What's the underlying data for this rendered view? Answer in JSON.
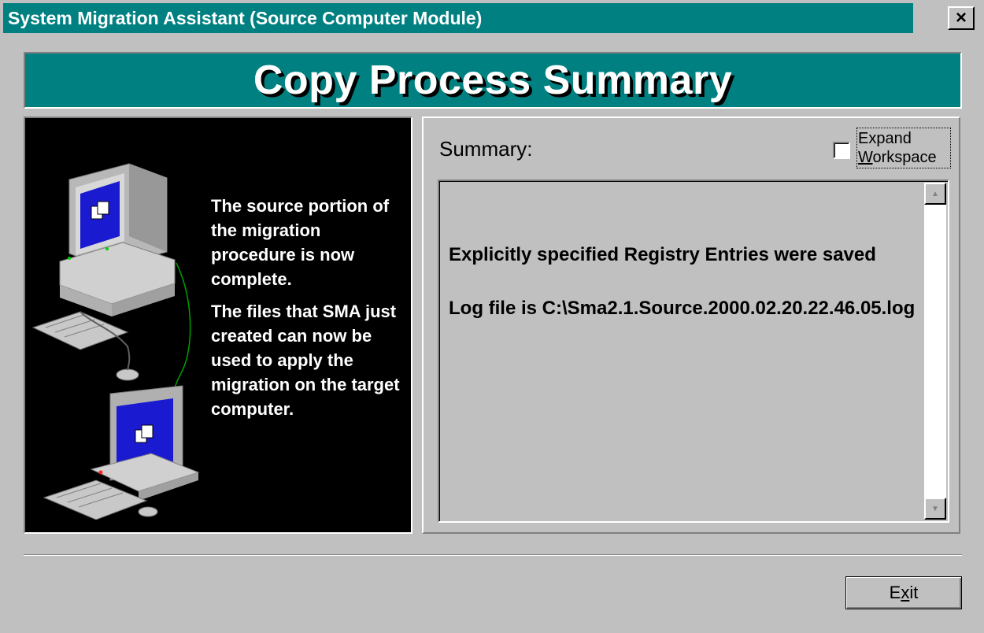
{
  "window": {
    "title": "System Migration Assistant (Source Computer Module)",
    "close_label": "×"
  },
  "banner": {
    "title": "Copy Process Summary"
  },
  "info_panel": {
    "paragraphs": [
      "The source portion of the migration procedure is now complete.",
      "The files that SMA just created can now be used to apply the migration on the target computer."
    ],
    "illustration": "two-computers-connected-by-cable"
  },
  "summary": {
    "label": "Summary:",
    "expand_label_line1": "Expand",
    "expand_label_line2_mnemonic": "W",
    "expand_label_line2_rest": "orkspace",
    "expand_checked": false,
    "lines": [
      "Explicitly specified Registry Entries were saved",
      "Log file is C:\\Sma2.1.Source.2000.02.20.22.46.05.log"
    ]
  },
  "footer": {
    "exit_pre": "E",
    "exit_mnemonic": "x",
    "exit_post": "it"
  },
  "colors": {
    "titlebar": "#008080",
    "banner": "#008080",
    "dialog_face": "#c0c0c0",
    "illustration_bg": "#000000"
  }
}
